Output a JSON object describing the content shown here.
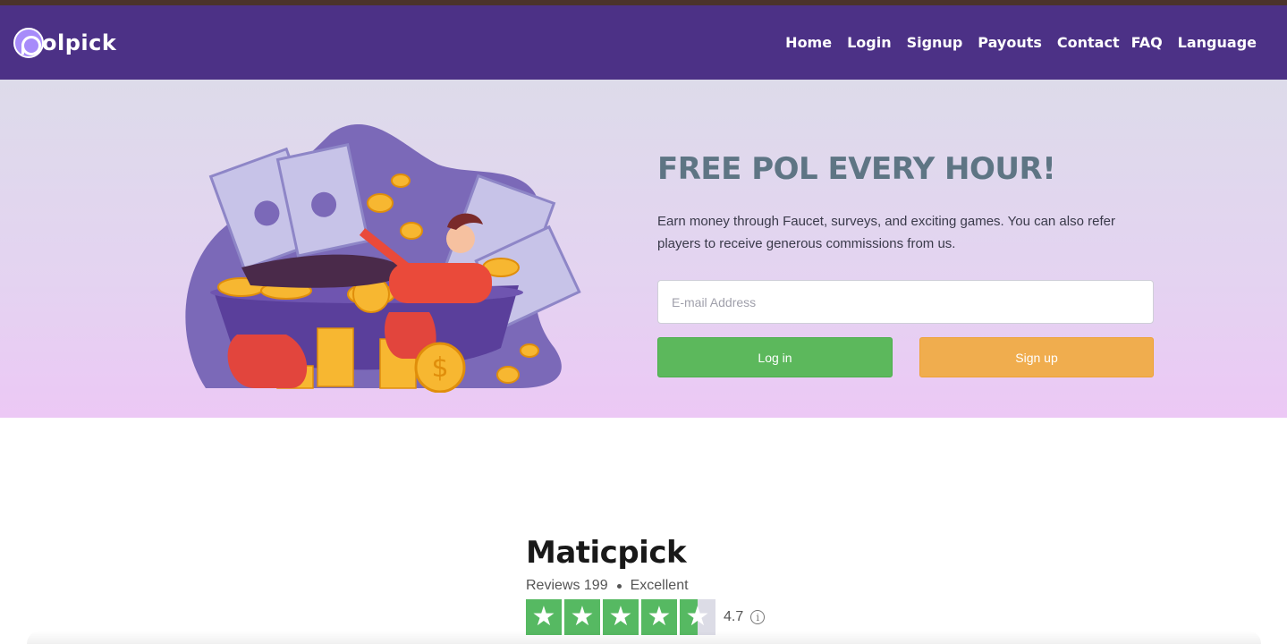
{
  "brand": {
    "name": "olpick"
  },
  "nav": {
    "items": [
      {
        "label": "Home"
      },
      {
        "label": "Login"
      },
      {
        "label": "Signup"
      },
      {
        "label": "Payouts"
      },
      {
        "label": "Contact"
      },
      {
        "label": "FAQ"
      },
      {
        "label": "Language"
      }
    ]
  },
  "hero": {
    "headline": "FREE POL EVERY HOUR!",
    "description": "Earn money through Faucet, surveys, and exciting games. You can also refer players to receive generous commissions from us.",
    "email_placeholder": "E-mail Address",
    "login_label": "Log in",
    "signup_label": "Sign up",
    "illustration_icon": "money-bath-illustration"
  },
  "review": {
    "name": "Maticpick",
    "reviews_label": "Reviews 199",
    "rating_word": "Excellent",
    "score": "4.7",
    "stars": 4.5
  },
  "colors": {
    "navbar": "#4c3186",
    "login_button": "#5cb85c",
    "signup_button": "#f0ad4e",
    "star_green": "#56b962",
    "headline": "#5e7584"
  }
}
